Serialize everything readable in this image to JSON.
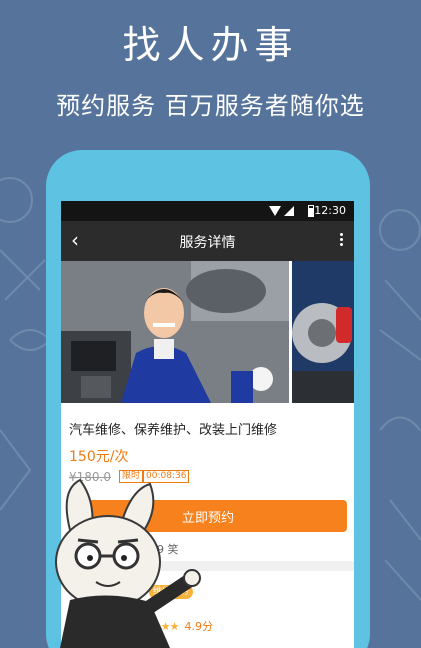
{
  "promo": {
    "headline": "找人办事",
    "subheadline": "预约服务 百万服务者随你选"
  },
  "status_bar": {
    "time": "12:30"
  },
  "nav": {
    "back_icon": "‹",
    "title": "服务详情"
  },
  "service": {
    "title": "汽车维修、保养维护、改装上门维修",
    "price": "150元/次",
    "original_price": "¥180.0",
    "limit_tag": "限时",
    "countdown": "00:08:36",
    "book_button": "立即预约",
    "stats": "769",
    "stats_suffix": "笑",
    "category_badge": "维修服务",
    "rating": "4.9分"
  },
  "colors": {
    "background": "#56749b",
    "phone_frame": "#5ec2e3",
    "accent_orange": "#f7811d",
    "nav_bar": "#2c2c2c"
  }
}
